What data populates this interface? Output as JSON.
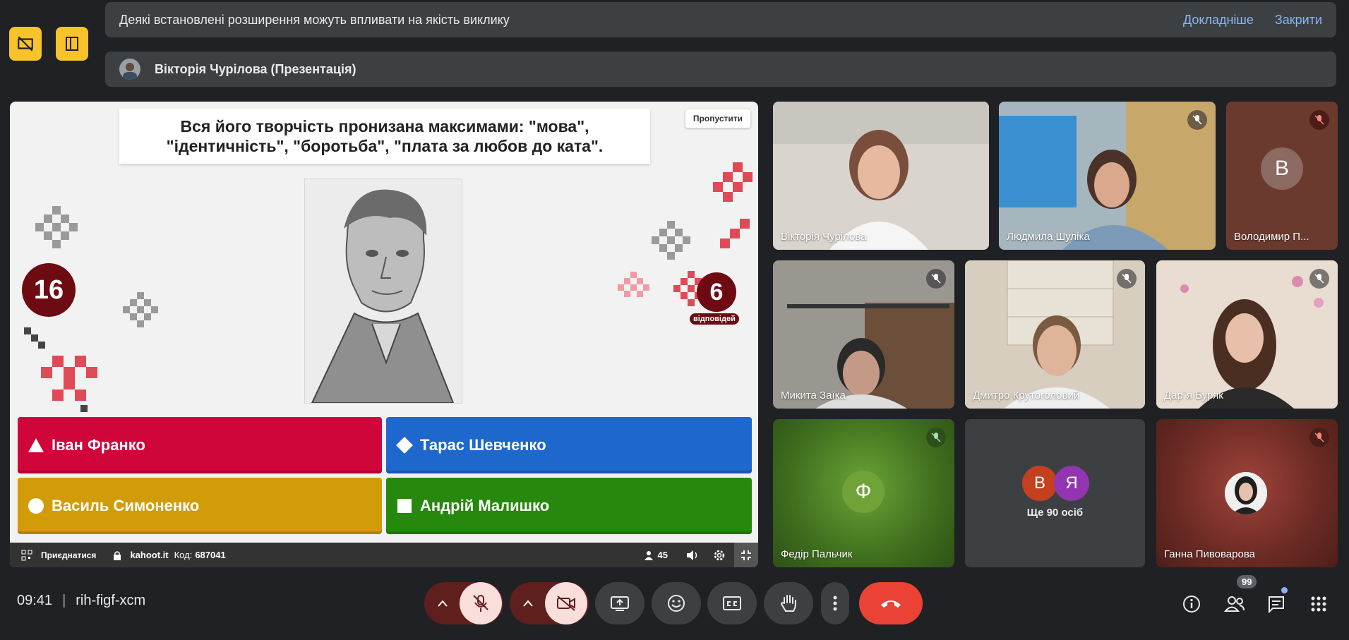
{
  "side_buttons": {
    "left_icon": "no-slides-icon",
    "right_icon": "companion-icon"
  },
  "extensions_banner": {
    "message": "Деякі встановлені розширення можуть впливати на якість виклику",
    "learn_more": "Докладніше",
    "close": "Закрити"
  },
  "presentation_banner": {
    "title": "Вікторія Чурілова (Презентація)"
  },
  "kahoot": {
    "question": "Вся його творчість пронизана максимами: \"мова\", \"ідентичність\", \"боротьба\", \"плата за любов до ката\".",
    "skip": "Пропустити",
    "timer": "16",
    "answers_count": "6",
    "answers_label": "відповідей",
    "answers": [
      {
        "label": "Іван Франко",
        "shape": "triangle",
        "color": "#d0053a"
      },
      {
        "label": "Тарас Шевченко",
        "shape": "diamond",
        "color": "#1d67cd"
      },
      {
        "label": "Василь Симоненко",
        "shape": "circle",
        "color": "#d29c08"
      },
      {
        "label": "Андрій Малишко",
        "shape": "square",
        "color": "#26890d"
      }
    ],
    "bar": {
      "join": "Приєднатися",
      "site": "kahoot.it",
      "code_label": "Код:",
      "code": "687041",
      "players": "45"
    }
  },
  "participants": [
    {
      "name": "Вікторія Чурілова",
      "muted": false
    },
    {
      "name": "Людмила Шуліка",
      "muted": true
    },
    {
      "name": "Володимир П...",
      "muted": true,
      "initial": "В"
    },
    {
      "name": "Микита Заїка",
      "muted": true
    },
    {
      "name": "Дмитро Крутоголовий",
      "muted": true
    },
    {
      "name": "Дар`я Буряк",
      "muted": true
    },
    {
      "name": "Федір Пальчик",
      "muted": true,
      "initial": "Ф"
    },
    {
      "name": "Ганна Пивоварова",
      "muted": true
    }
  ],
  "more_tile": {
    "label": "Ще 90 осіб",
    "initials": [
      "В",
      "Я"
    ]
  },
  "bottom_bar": {
    "time": "09:41",
    "separator": "|",
    "meeting_code": "rih-figf-xcm",
    "people_count": "99"
  },
  "colors": {
    "accent": "#8ab4f8",
    "end_call": "#ea4335",
    "muted_ctrl": "#f9dedc",
    "timer": "#6e0a12"
  }
}
